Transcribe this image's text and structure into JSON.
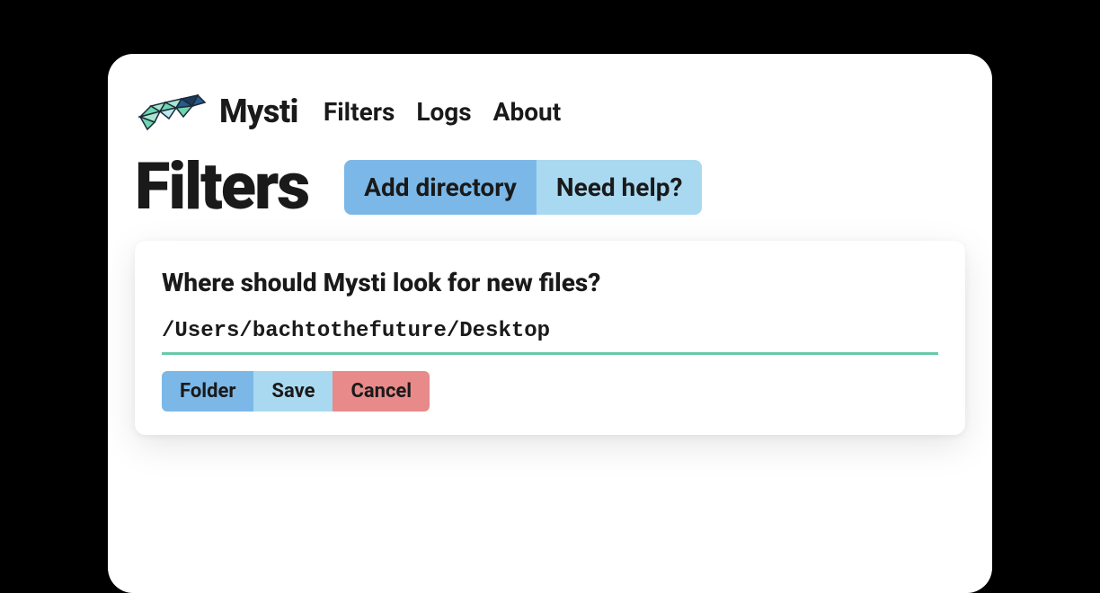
{
  "brand": {
    "name": "Mysti"
  },
  "nav": {
    "items": [
      {
        "label": "Filters"
      },
      {
        "label": "Logs"
      },
      {
        "label": "About"
      }
    ]
  },
  "page": {
    "title": "Filters"
  },
  "actions": {
    "add_directory": "Add directory",
    "need_help": "Need help?"
  },
  "form": {
    "question": "Where should Mysti look for new files?",
    "path_value": "/Users/bachtothefuture/Desktop",
    "folder_label": "Folder",
    "save_label": "Save",
    "cancel_label": "Cancel"
  },
  "colors": {
    "accent_blue": "#7bb8e8",
    "accent_lightblue": "#a9d9f0",
    "accent_red": "#e88a8a",
    "accent_teal": "#69c9a8"
  }
}
